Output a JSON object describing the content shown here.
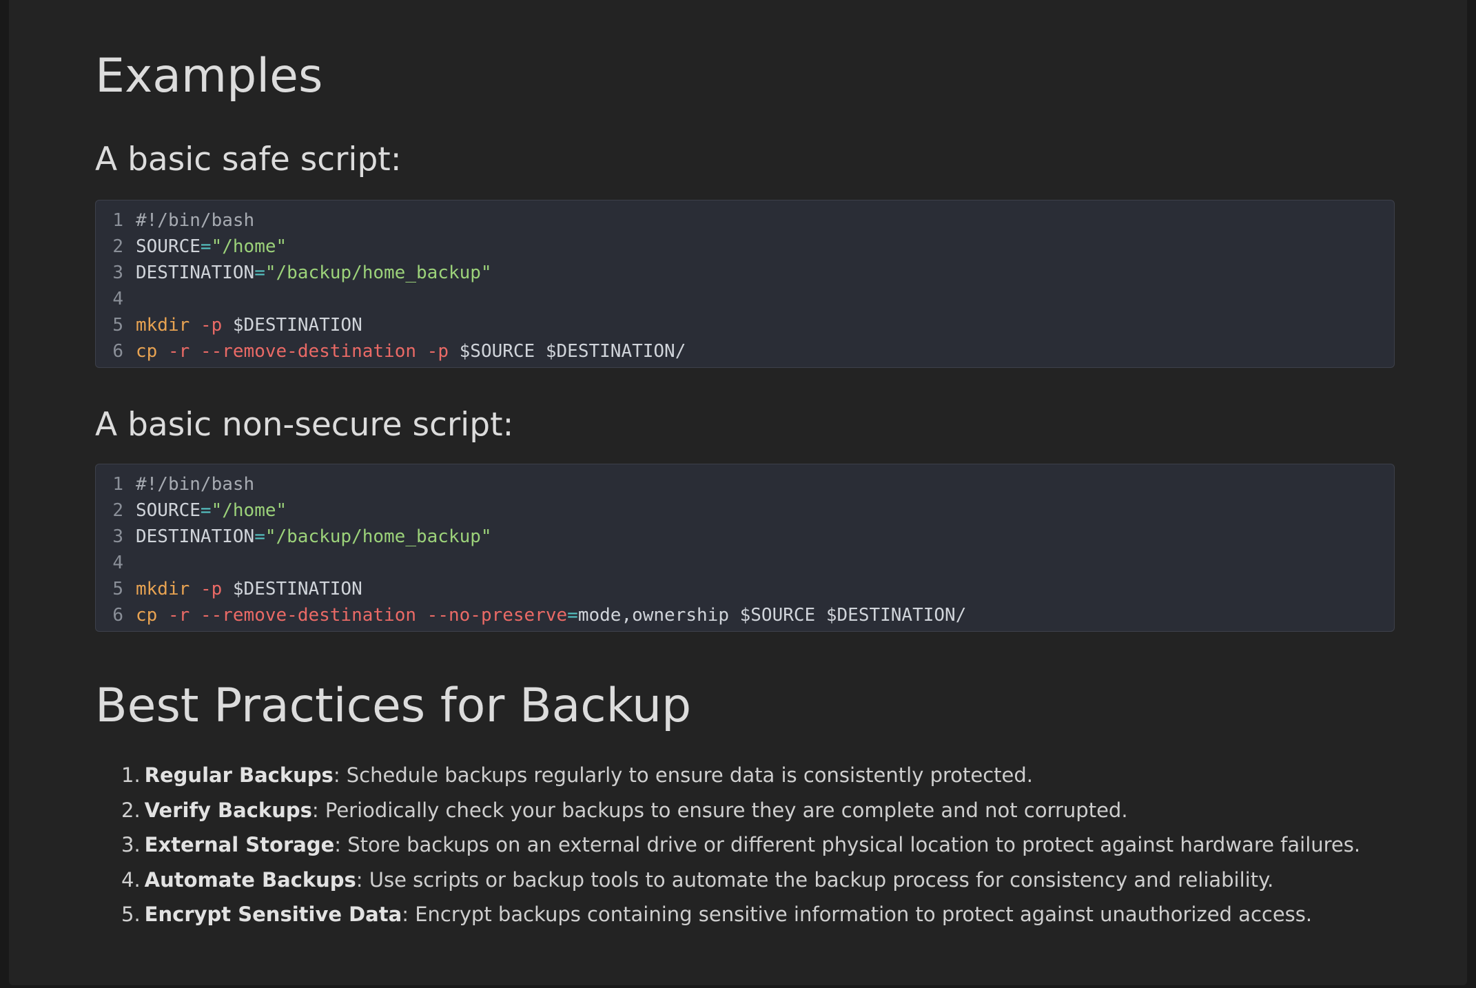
{
  "examples_heading": "Examples",
  "safe_script": {
    "heading": "A basic safe script:",
    "lines": [
      {
        "n": "1",
        "tokens": [
          {
            "t": "comment",
            "v": "#!/bin/bash"
          }
        ]
      },
      {
        "n": "2",
        "tokens": [
          {
            "t": "var",
            "v": "SOURCE"
          },
          {
            "t": "op",
            "v": "="
          },
          {
            "t": "str",
            "v": "\"/home\""
          }
        ]
      },
      {
        "n": "3",
        "tokens": [
          {
            "t": "var",
            "v": "DESTINATION"
          },
          {
            "t": "op",
            "v": "="
          },
          {
            "t": "str",
            "v": "\"/backup/home_backup\""
          }
        ]
      },
      {
        "n": "4",
        "tokens": []
      },
      {
        "n": "5",
        "tokens": [
          {
            "t": "cmd",
            "v": "mkdir"
          },
          {
            "t": "plain",
            "v": " "
          },
          {
            "t": "flag",
            "v": "-p"
          },
          {
            "t": "plain",
            "v": " $DESTINATION"
          }
        ]
      },
      {
        "n": "6",
        "tokens": [
          {
            "t": "cmd",
            "v": "cp"
          },
          {
            "t": "plain",
            "v": " "
          },
          {
            "t": "flag",
            "v": "-r"
          },
          {
            "t": "plain",
            "v": " "
          },
          {
            "t": "flag",
            "v": "--remove-destination"
          },
          {
            "t": "plain",
            "v": " "
          },
          {
            "t": "flag",
            "v": "-p"
          },
          {
            "t": "plain",
            "v": " $SOURCE $DESTINATION/"
          }
        ]
      }
    ]
  },
  "unsafe_script": {
    "heading": "A basic non-secure script:",
    "lines": [
      {
        "n": "1",
        "tokens": [
          {
            "t": "comment",
            "v": "#!/bin/bash"
          }
        ]
      },
      {
        "n": "2",
        "tokens": [
          {
            "t": "var",
            "v": "SOURCE"
          },
          {
            "t": "op",
            "v": "="
          },
          {
            "t": "str",
            "v": "\"/home\""
          }
        ]
      },
      {
        "n": "3",
        "tokens": [
          {
            "t": "var",
            "v": "DESTINATION"
          },
          {
            "t": "op",
            "v": "="
          },
          {
            "t": "str",
            "v": "\"/backup/home_backup\""
          }
        ]
      },
      {
        "n": "4",
        "tokens": []
      },
      {
        "n": "5",
        "tokens": [
          {
            "t": "cmd",
            "v": "mkdir"
          },
          {
            "t": "plain",
            "v": " "
          },
          {
            "t": "flag",
            "v": "-p"
          },
          {
            "t": "plain",
            "v": " $DESTINATION"
          }
        ]
      },
      {
        "n": "6",
        "tokens": [
          {
            "t": "cmd",
            "v": "cp"
          },
          {
            "t": "plain",
            "v": " "
          },
          {
            "t": "flag",
            "v": "-r"
          },
          {
            "t": "plain",
            "v": " "
          },
          {
            "t": "flag",
            "v": "--remove-destination"
          },
          {
            "t": "plain",
            "v": " "
          },
          {
            "t": "flag",
            "v": "--no-preserve"
          },
          {
            "t": "op",
            "v": "="
          },
          {
            "t": "plain",
            "v": "mode,ownership $SOURCE $DESTINATION/"
          }
        ]
      }
    ]
  },
  "best_practices": {
    "heading": "Best Practices for Backup",
    "items": [
      {
        "num": "1.",
        "title": "Regular Backups",
        "desc": ": Schedule backups regularly to ensure data is consistently protected."
      },
      {
        "num": "2.",
        "title": "Verify Backups",
        "desc": ": Periodically check your backups to ensure they are complete and not corrupted."
      },
      {
        "num": "3.",
        "title": "External Storage",
        "desc": ": Store backups on an external drive or different physical location to protect against hardware failures."
      },
      {
        "num": "4.",
        "title": "Automate Backups",
        "desc": ": Use scripts or backup tools to automate the backup process for consistency and reliability."
      },
      {
        "num": "5.",
        "title": "Encrypt Sensitive Data",
        "desc": ": Encrypt backups containing sensitive information to protect against unauthorized access."
      }
    ]
  }
}
